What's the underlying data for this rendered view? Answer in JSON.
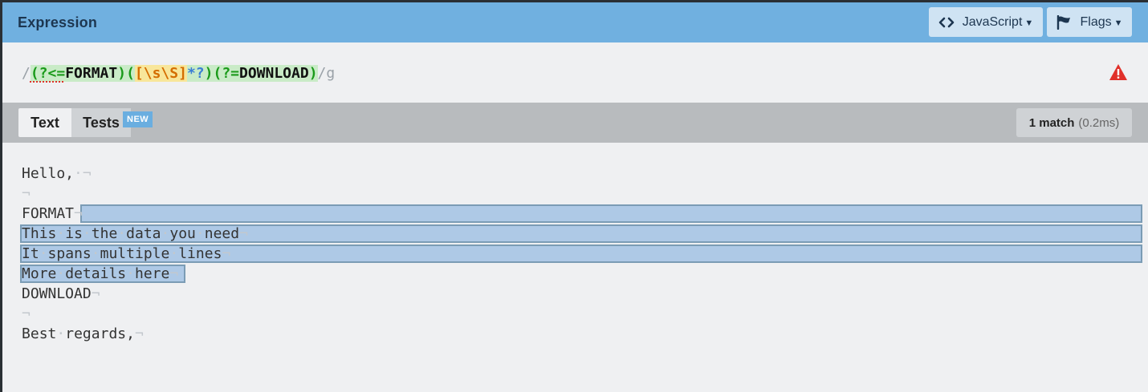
{
  "header": {
    "title": "Expression",
    "flavor_button": "JavaScript",
    "flags_button": "Flags"
  },
  "expression": {
    "open_slash": "/",
    "lookbehind_open": "(?<=",
    "lookbehind_text": "FORMAT",
    "lookbehind_close": ")",
    "group_open": "(",
    "char_set": "[\\s\\S]",
    "quantifier": "*?",
    "group_close": ")",
    "lookahead_open": "(?=",
    "lookahead_text": "DOWNLOAD",
    "lookahead_close": ")",
    "close_slash": "/",
    "flags": "g",
    "warning_icon": "warning-triangle-icon"
  },
  "tabs": {
    "text_label": "Text",
    "tests_label": "Tests",
    "new_badge": "NEW"
  },
  "match_info": {
    "count": "1 match",
    "time": "(0.2ms)"
  },
  "text_lines": [
    {
      "text": "Hello,",
      "tail": "·¬"
    },
    {
      "text": "",
      "tail": "¬"
    },
    {
      "text": "FORMAT",
      "tail": "¬"
    },
    {
      "text": "This·is·the·data·you·need",
      "tail": "¬"
    },
    {
      "text": "It·spans·multiple·lines",
      "tail": "¬"
    },
    {
      "text": "More·details·here",
      "tail": "¬"
    },
    {
      "text": "DOWNLOAD",
      "tail": "¬"
    },
    {
      "text": "",
      "tail": "¬"
    },
    {
      "text": "Best·regards,",
      "tail": "¬"
    }
  ],
  "colors": {
    "header_bg": "#70b0e0",
    "match_highlight": "#a8cbe8",
    "group_green": "#1a9a1a",
    "set_orange": "#d46d00",
    "quantifier_blue": "#3a7ed5",
    "warning_red": "#e0302a"
  }
}
